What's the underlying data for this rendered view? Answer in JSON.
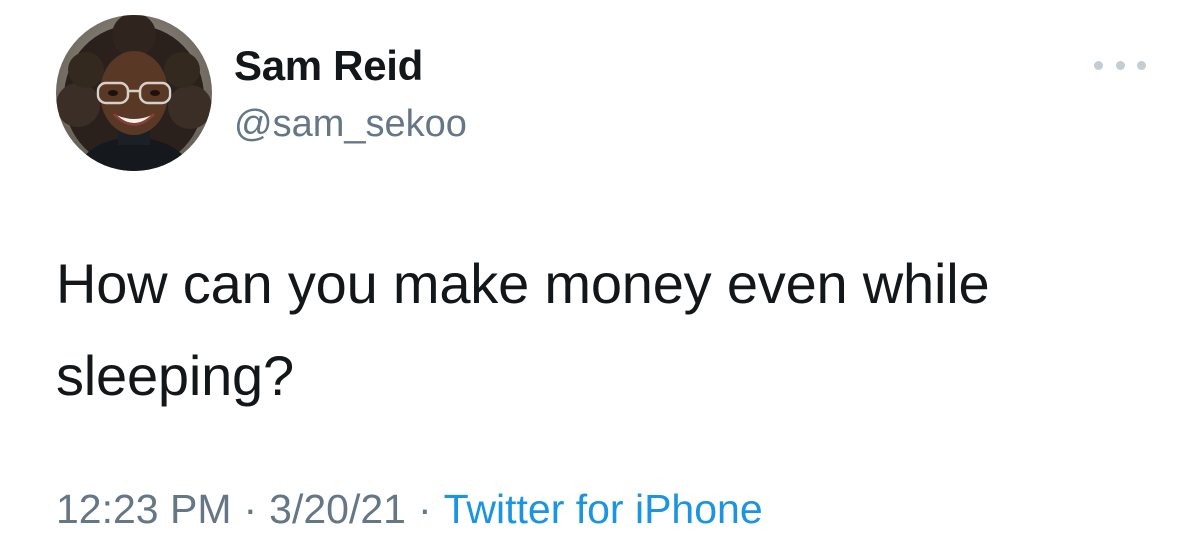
{
  "author": {
    "display_name": "Sam Reid",
    "handle": "@sam_sekoo",
    "avatar_icon": "profile-photo"
  },
  "tweet": {
    "text": "How can you make money even while sleeping?"
  },
  "meta": {
    "time": "12:23 PM",
    "separator": "·",
    "date": "3/20/21",
    "source": "Twitter for iPhone"
  },
  "menu": {
    "icon": "more-options-icon"
  },
  "colors": {
    "text_primary": "#14171a",
    "text_secondary": "#657786",
    "link": "#1b95e0",
    "menu_dots": "#c4ccd4"
  }
}
